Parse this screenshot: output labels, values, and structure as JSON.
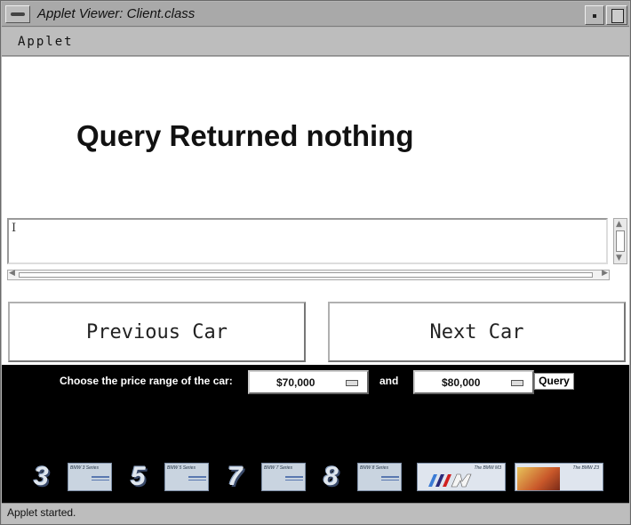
{
  "window": {
    "title": "Applet Viewer: Client.class"
  },
  "menubar": {
    "applet_label": "Applet"
  },
  "content": {
    "message": "Query Returned nothing",
    "text_area_value": "",
    "prev_button": "Previous Car",
    "next_button": "Next Car"
  },
  "query_panel": {
    "price_label": "Choose the price range of the car:",
    "min_price": "$70,000",
    "and_label": "and",
    "max_price": "$80,000",
    "query_button": "Query",
    "series": [
      {
        "number": "3",
        "caption": "BMW 3 Series"
      },
      {
        "number": "5",
        "caption": "BMW 5 Series"
      },
      {
        "number": "7",
        "caption": "BMW 7 Series"
      },
      {
        "number": "8",
        "caption": "BMW 8 Series"
      }
    ],
    "m3_caption": "The BMW M3",
    "z3_caption": "The BMW Z3"
  },
  "status": {
    "text": "Applet started."
  },
  "colors": {
    "panel_bg": "#000000",
    "content_bg": "#ffffff",
    "chrome": "#b5b5b5"
  }
}
